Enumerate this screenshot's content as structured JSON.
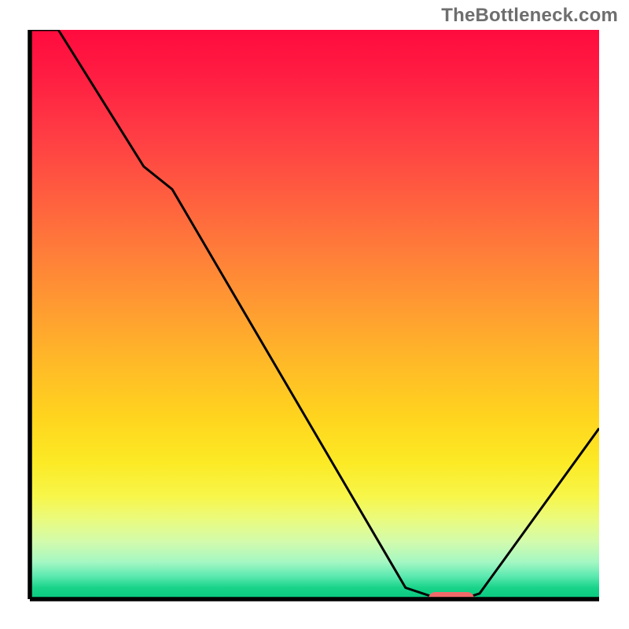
{
  "watermark": "TheBottleneck.com",
  "colors": {
    "axis": "#000000",
    "curve": "#000000",
    "marker": "#f06a6a",
    "watermark_text": "#6e6e6e"
  },
  "chart_data": {
    "type": "line",
    "title": "",
    "xlabel": "",
    "ylabel": "",
    "xlim": [
      0,
      100
    ],
    "ylim": [
      0,
      100
    ],
    "x": [
      0,
      5,
      20,
      25,
      66,
      72,
      76,
      79,
      100
    ],
    "values": [
      100,
      100,
      76,
      72,
      2,
      0,
      0,
      1,
      30
    ],
    "marker": {
      "x_start": 70,
      "x_end": 78,
      "y": 0
    },
    "annotations": []
  }
}
